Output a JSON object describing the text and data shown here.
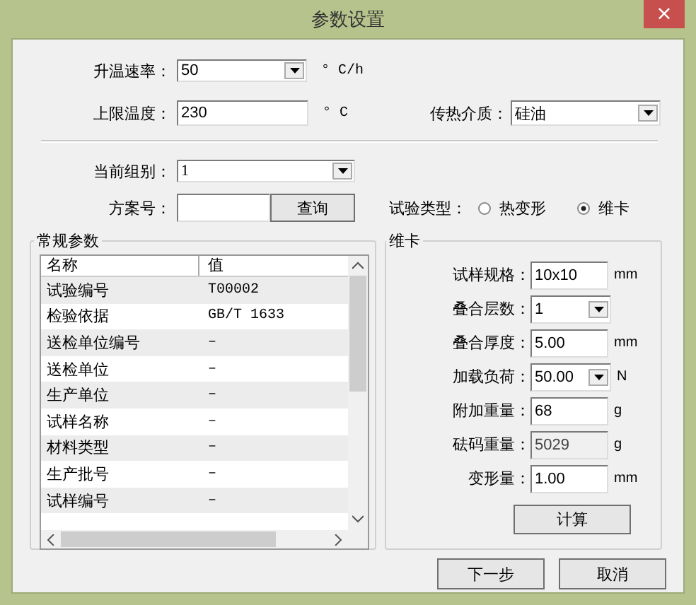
{
  "window": {
    "title": "参数设置",
    "close": "×"
  },
  "heating": [
    {
      "label": "升温速率：",
      "kind": "select",
      "value": "50",
      "unit": "° C/h"
    },
    {
      "label": "上限温度：",
      "kind": "input",
      "value": "230",
      "unit": "° C"
    }
  ],
  "medium": {
    "label": "传热介质：",
    "value": "硅油"
  },
  "group": {
    "label": "当前组别：",
    "value": "1"
  },
  "scheme": {
    "label": "方案号：",
    "button": "查询"
  },
  "test_type": {
    "label": "试验类型：",
    "options": [
      {
        "label": "热变形",
        "selected": false
      },
      {
        "label": "维卡",
        "selected": true
      }
    ]
  },
  "general": {
    "title": "常规参数",
    "columns": [
      "名称",
      "值"
    ],
    "rows": [
      {
        "name": "试验编号",
        "value": "T00002"
      },
      {
        "name": "检验依据",
        "value": "GB/T 1633"
      },
      {
        "name": "送检单位编号",
        "value": "–"
      },
      {
        "name": "送检单位",
        "value": "–"
      },
      {
        "name": "生产单位",
        "value": "–"
      },
      {
        "name": "试样名称",
        "value": "–"
      },
      {
        "name": "材料类型",
        "value": "–"
      },
      {
        "name": "生产批号",
        "value": "–"
      },
      {
        "name": "试样编号",
        "value": "–"
      }
    ]
  },
  "vicat": {
    "title": "维卡",
    "fields": [
      {
        "label": "试样规格：",
        "kind": "input",
        "value": "10x10",
        "unit": "mm",
        "disabled": false
      },
      {
        "label": "叠合层数：",
        "kind": "select",
        "value": "1",
        "disabled": false
      },
      {
        "label": "叠合厚度：",
        "kind": "input",
        "value": "5.00",
        "unit": "mm",
        "disabled": false
      },
      {
        "label": "加载负荷：",
        "kind": "select",
        "value": "50.00",
        "unit": "N",
        "disabled": false
      },
      {
        "label": "附加重量：",
        "kind": "input",
        "value": "68",
        "unit": "g",
        "disabled": false
      },
      {
        "label": "砝码重量：",
        "kind": "input",
        "value": "5029",
        "unit": "g",
        "disabled": true
      },
      {
        "label": "变形量：",
        "kind": "input",
        "value": "1.00",
        "unit": "mm",
        "disabled": false
      }
    ],
    "button": "计算"
  },
  "buttons": [
    "下一步",
    "取消"
  ]
}
